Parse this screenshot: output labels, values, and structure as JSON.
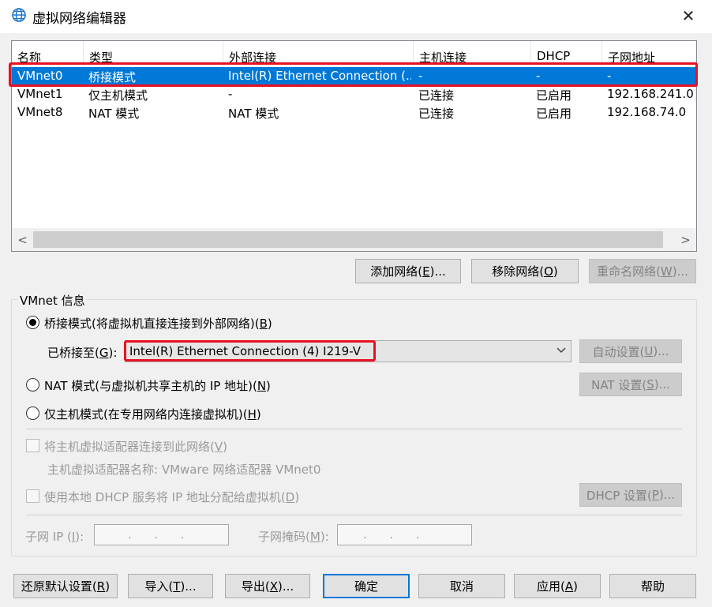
{
  "window": {
    "title": "虚拟网络编辑器",
    "icon": "globe-icon",
    "close_glyph": "✕"
  },
  "list": {
    "columns": [
      "名称",
      "类型",
      "外部连接",
      "主机连接",
      "DHCP",
      "子网地址"
    ],
    "rows": [
      {
        "name": "VMnet0",
        "type": "桥接模式",
        "external": "Intel(R) Ethernet Connection (...",
        "host": "-",
        "dhcp": "-",
        "subnet": "-"
      },
      {
        "name": "VMnet1",
        "type": "仅主机模式",
        "external": "-",
        "host": "已连接",
        "dhcp": "已启用",
        "subnet": "192.168.241.0"
      },
      {
        "name": "VMnet8",
        "type": "NAT 模式",
        "external": "NAT 模式",
        "host": "已连接",
        "dhcp": "已启用",
        "subnet": "192.168.74.0"
      }
    ],
    "selected_row": 0,
    "scroll_left_glyph": "<",
    "scroll_right_glyph": ">"
  },
  "net_buttons": {
    "add": {
      "pre": "添加网络(",
      "key": "E",
      "post": ")..."
    },
    "remove": {
      "pre": "移除网络(",
      "key": "O",
      "post": ")"
    },
    "rename": {
      "pre": "重命名网络(",
      "key": "W",
      "post": ")..."
    }
  },
  "info": {
    "group_title": "VMnet 信息",
    "bridged": {
      "pre": "桥接模式(将虚拟机直接连接到外部网络)(",
      "key": "B",
      "post": ")"
    },
    "bridged_to": {
      "pre": "已桥接至(",
      "key": "G",
      "post": "):"
    },
    "bridged_adapter": "Intel(R) Ethernet Connection (4) I219-V",
    "auto_settings": {
      "pre": "自动设置(",
      "key": "U",
      "post": ")..."
    },
    "nat": {
      "pre": "NAT 模式(与虚拟机共享主机的 IP 地址)(",
      "key": "N",
      "post": ")"
    },
    "nat_settings": {
      "pre": "NAT 设置(",
      "key": "S",
      "post": ")..."
    },
    "host_only": {
      "pre": "仅主机模式(在专用网络内连接虚拟机)(",
      "key": "H",
      "post": ")"
    },
    "connect_adapter": {
      "pre": "将主机虚拟适配器连接到此网络(",
      "key": "V",
      "post": ")"
    },
    "adapter_name": "主机虚拟适配器名称: VMware 网络适配器 VMnet0",
    "use_dhcp": {
      "pre": "使用本地 DHCP 服务将 IP 地址分配给虚拟机(",
      "key": "D",
      "post": ")"
    },
    "dhcp_settings": {
      "pre": "DHCP 设置(",
      "key": "P",
      "post": ")..."
    },
    "subnet_ip": {
      "pre": "子网 IP (",
      "key": "I",
      "post": "):"
    },
    "subnet_mask": {
      "pre": "子网掩码(",
      "key": "M",
      "post": "):"
    },
    "ip_placeholder": ".      .      ."
  },
  "bottom_buttons": {
    "restore": {
      "pre": "还原默认设置(",
      "key": "R",
      "post": ")"
    },
    "import": {
      "pre": "导入(",
      "key": "T",
      "post": ")..."
    },
    "export": {
      "pre": "导出(",
      "key": "X",
      "post": ")..."
    },
    "ok": "确定",
    "cancel": "取消",
    "apply": {
      "pre": "应用(",
      "key": "A",
      "post": ")"
    },
    "help": "帮助"
  },
  "colors": {
    "selection": "#0078d7",
    "highlight_box": "#e81123"
  }
}
